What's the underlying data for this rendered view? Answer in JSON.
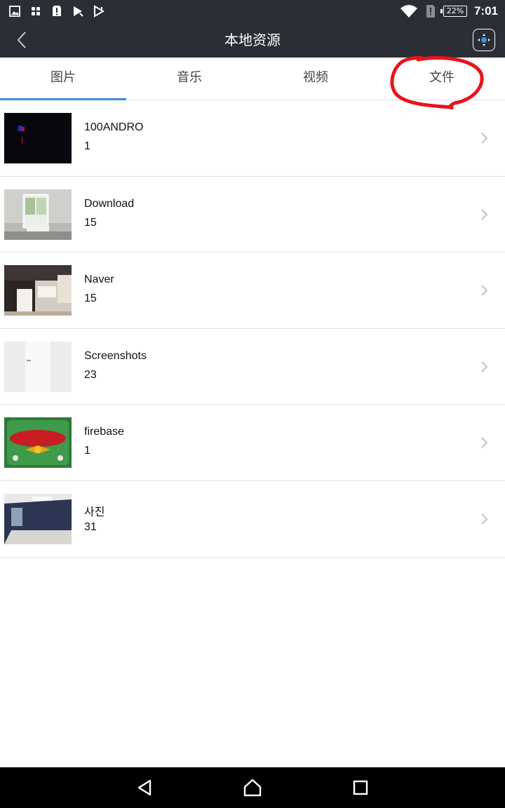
{
  "status_bar": {
    "battery": "22%",
    "time": "7:01"
  },
  "app_bar": {
    "title": "本地资源"
  },
  "tabs": [
    {
      "label": "图片",
      "active": true
    },
    {
      "label": "音乐",
      "active": false
    },
    {
      "label": "视频",
      "active": false
    },
    {
      "label": "文件",
      "active": false
    }
  ],
  "folders": [
    {
      "name": "100ANDRO",
      "count": "1"
    },
    {
      "name": "Download",
      "count": "15"
    },
    {
      "name": "Naver",
      "count": "15"
    },
    {
      "name": "Screenshots",
      "count": "23"
    },
    {
      "name": "firebase",
      "count": "1"
    },
    {
      "name": "사진",
      "count": "31"
    }
  ],
  "colors": {
    "header_bg": "#2b2e35",
    "tab_indicator": "#3d8fd6",
    "annotation": "#e8141c"
  }
}
